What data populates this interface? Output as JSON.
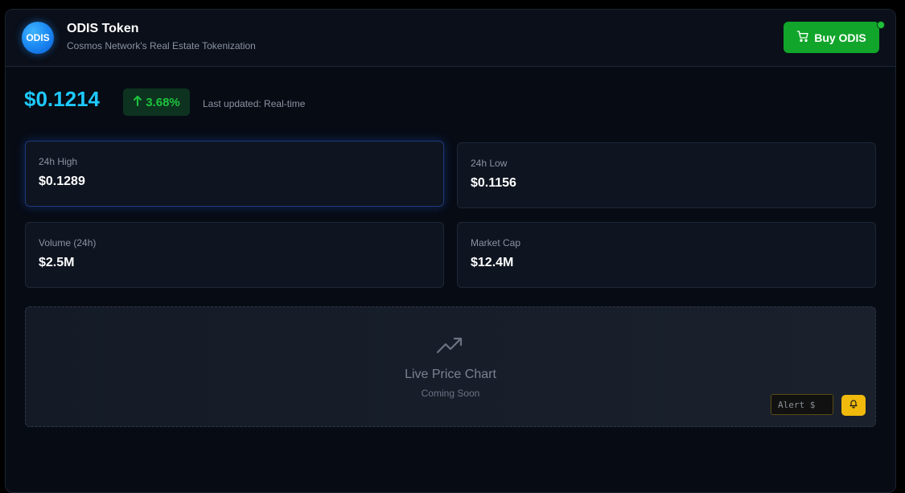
{
  "header": {
    "logo_text": "ODIS",
    "title": "ODIS Token",
    "subtitle": "Cosmos Network's Real Estate Tokenization",
    "buy_button_label": "Buy ODIS",
    "buy_icon": "cart-icon",
    "status_dot_color": "#1fbf3a"
  },
  "price": {
    "value": "$0.1214",
    "change": "3.68%",
    "change_icon": "arrow-up-icon",
    "updated": "Last updated: Real-time"
  },
  "stats": [
    {
      "label": "24h High",
      "value": "$0.1289"
    },
    {
      "label": "24h Low",
      "value": "$0.1156"
    },
    {
      "label": "Volume (24h)",
      "value": "$2.5M"
    },
    {
      "label": "Market Cap",
      "value": "$12.4M"
    }
  ],
  "chart_placeholder": {
    "icon": "trending-up-icon",
    "title": "Live Price Chart",
    "subtitle": "Coming Soon"
  },
  "alert": {
    "placeholder": "Alert $",
    "button_icon": "bell-icon"
  },
  "colors": {
    "accent": "#1ec9ff",
    "positive": "#1ec43d",
    "buy": "#11a52b",
    "alert": "#f0b90b"
  }
}
